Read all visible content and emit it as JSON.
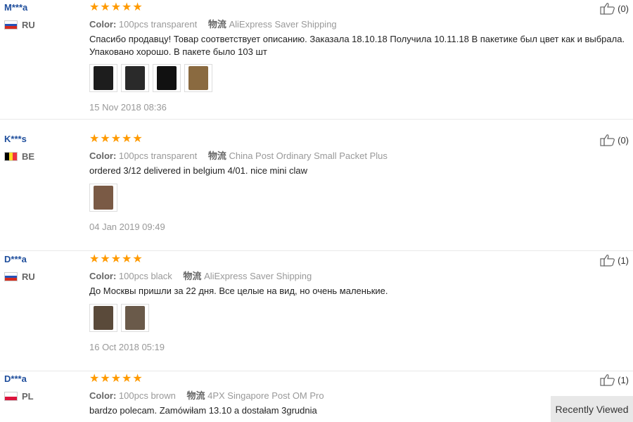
{
  "reviews": [
    {
      "user": "M***a",
      "country": "RU",
      "flag": [
        "#ffffff",
        "#2452b8",
        "#d52b1e"
      ],
      "stars": [
        "★",
        "★",
        "★",
        "★",
        "★"
      ],
      "color_label": "Color:",
      "color_value": "100pcs transparent",
      "shipping_label": "物流",
      "shipping_value": "AliExpress Saver Shipping",
      "text": "Спасибо продавцу! Товар соответствует описанию. Заказала 18.10.18 Получила 10.11.18 В пакетике был цвет как и выбрала. Упаковано хорошо. В пакете было 103 шт",
      "photos": [
        "#1d1d1d",
        "#2a2a2a",
        "#111111",
        "#8a6a40"
      ],
      "date": "15 Nov 2018 08:36",
      "helpful": "(0)"
    },
    {
      "user": "K***s",
      "country": "BE",
      "flag": [
        "#000000",
        "#fdda24",
        "#ef3340"
      ],
      "stars": [
        "★",
        "★",
        "★",
        "★",
        "★"
      ],
      "color_label": "Color:",
      "color_value": "100pcs transparent",
      "shipping_label": "物流",
      "shipping_value": "China Post Ordinary Small Packet Plus",
      "text": "ordered 3/12 delivered in belgium 4/01. nice mini claw",
      "photos": [
        "#7a5a45"
      ],
      "date": "04 Jan 2019 09:49",
      "helpful": "(0)"
    },
    {
      "user": "D***a",
      "country": "RU",
      "flag": [
        "#ffffff",
        "#2452b8",
        "#d52b1e"
      ],
      "stars": [
        "★",
        "★",
        "★",
        "★",
        "★"
      ],
      "color_label": "Color:",
      "color_value": "100pcs black",
      "shipping_label": "物流",
      "shipping_value": "AliExpress Saver Shipping",
      "text": "До Москвы пришли за 22 дня. Все целые на вид, но очень маленькие.",
      "photos": [
        "#5a4a3a",
        "#6a5a4a"
      ],
      "date": "16 Oct 2018 05:19",
      "helpful": "(1)"
    },
    {
      "user": "D***a",
      "country": "PL",
      "flag": [
        "#ffffff",
        "#dc143c"
      ],
      "stars": [
        "★",
        "★",
        "★",
        "★",
        "★"
      ],
      "color_label": "Color:",
      "color_value": "100pcs brown",
      "shipping_label": "物流",
      "shipping_value": "4PX Singapore Post OM Pro",
      "text": "bardzo polecam. Zamówiłam 13.10 a dostałam 3grudnia",
      "photos": [],
      "date": "",
      "helpful": "(1)"
    }
  ],
  "recently_viewed": "Recently Viewed",
  "colors": {
    "user": "#1f4e9c",
    "star": "#ff9a00",
    "muted": "#999999"
  }
}
